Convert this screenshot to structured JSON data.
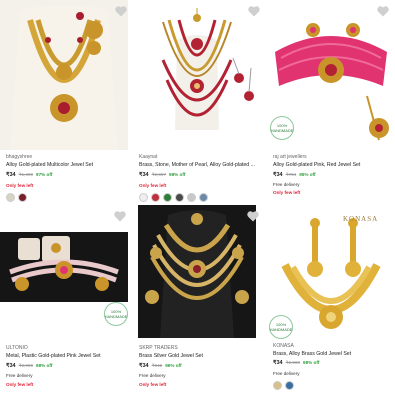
{
  "products": [
    {
      "brand": "bhagyshree",
      "title": "Alloy Gold-plated Multicolor Jewel Set",
      "price": "₹34",
      "mrp": "₹1,499",
      "off": "97% off",
      "delivery": "",
      "stock": "Only few left",
      "swatches": [
        "#d8d2c0",
        "#7a1e2a"
      ]
    },
    {
      "brand": "Kaaynat",
      "title": "Brass, Stone, Mother of Pearl, Alloy Gold-plated ...",
      "price": "₹34",
      "mrp": "₹2,997",
      "off": "98% off",
      "delivery": "",
      "stock": "Only few left",
      "swatches": [
        "#eeeeee",
        "#c0303a",
        "#2e7d3a",
        "#4a4a4a",
        "#c8c8c8",
        "#6a8aa8"
      ]
    },
    {
      "brand": "raj art jewellers",
      "title": "Alloy Gold-plated Pink, Red Jewel Set",
      "price": "₹34",
      "mrp": "₹794",
      "off": "95% off",
      "delivery": "Free delivery",
      "stock": "Only few left",
      "swatches": []
    },
    {
      "brand": "ULTONIO",
      "title": "Metal, Plastic Gold-plated Pink Jewel Set",
      "price": "₹34",
      "mrp": "₹2,999",
      "off": "98% off",
      "delivery": "Free delivery",
      "stock": "Only few left",
      "swatches": []
    },
    {
      "brand": "SKRP TRADERS",
      "title": "Brass Silver Gold Jewel Set",
      "price": "₹34",
      "mrp": "₹942",
      "off": "96% off",
      "delivery": "Free delivery",
      "stock": "Only few left",
      "swatches": []
    },
    {
      "brand": "KONASA",
      "title": "Brass, Alloy Brass Gold Jewel Set",
      "price": "₹34",
      "mrp": "₹2,000",
      "off": "98% off",
      "delivery": "Free delivery",
      "stock": "",
      "swatches": [
        "#d9c08a",
        "#3a6ea0"
      ]
    }
  ],
  "badge_text": "100%\nHANDMADE",
  "konasa_logo": "KONASA",
  "icons": [
    "heart-icon"
  ]
}
